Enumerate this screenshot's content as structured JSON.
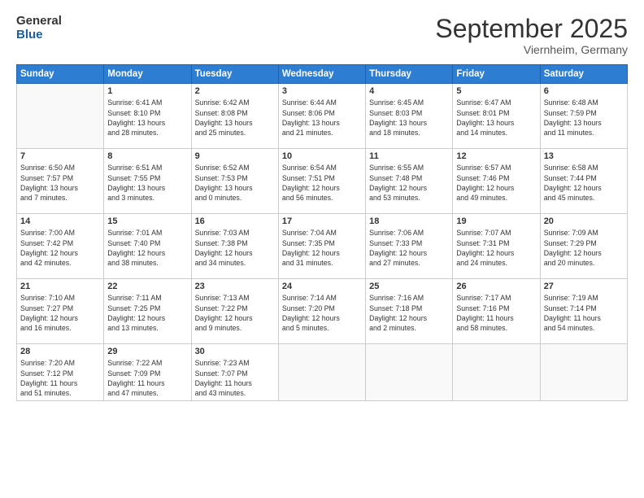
{
  "logo": {
    "general": "General",
    "blue": "Blue"
  },
  "title": "September 2025",
  "location": "Viernheim, Germany",
  "days_of_week": [
    "Sunday",
    "Monday",
    "Tuesday",
    "Wednesday",
    "Thursday",
    "Friday",
    "Saturday"
  ],
  "weeks": [
    [
      {
        "day": "",
        "info": ""
      },
      {
        "day": "1",
        "info": "Sunrise: 6:41 AM\nSunset: 8:10 PM\nDaylight: 13 hours\nand 28 minutes."
      },
      {
        "day": "2",
        "info": "Sunrise: 6:42 AM\nSunset: 8:08 PM\nDaylight: 13 hours\nand 25 minutes."
      },
      {
        "day": "3",
        "info": "Sunrise: 6:44 AM\nSunset: 8:06 PM\nDaylight: 13 hours\nand 21 minutes."
      },
      {
        "day": "4",
        "info": "Sunrise: 6:45 AM\nSunset: 8:03 PM\nDaylight: 13 hours\nand 18 minutes."
      },
      {
        "day": "5",
        "info": "Sunrise: 6:47 AM\nSunset: 8:01 PM\nDaylight: 13 hours\nand 14 minutes."
      },
      {
        "day": "6",
        "info": "Sunrise: 6:48 AM\nSunset: 7:59 PM\nDaylight: 13 hours\nand 11 minutes."
      }
    ],
    [
      {
        "day": "7",
        "info": "Sunrise: 6:50 AM\nSunset: 7:57 PM\nDaylight: 13 hours\nand 7 minutes."
      },
      {
        "day": "8",
        "info": "Sunrise: 6:51 AM\nSunset: 7:55 PM\nDaylight: 13 hours\nand 3 minutes."
      },
      {
        "day": "9",
        "info": "Sunrise: 6:52 AM\nSunset: 7:53 PM\nDaylight: 13 hours\nand 0 minutes."
      },
      {
        "day": "10",
        "info": "Sunrise: 6:54 AM\nSunset: 7:51 PM\nDaylight: 12 hours\nand 56 minutes."
      },
      {
        "day": "11",
        "info": "Sunrise: 6:55 AM\nSunset: 7:48 PM\nDaylight: 12 hours\nand 53 minutes."
      },
      {
        "day": "12",
        "info": "Sunrise: 6:57 AM\nSunset: 7:46 PM\nDaylight: 12 hours\nand 49 minutes."
      },
      {
        "day": "13",
        "info": "Sunrise: 6:58 AM\nSunset: 7:44 PM\nDaylight: 12 hours\nand 45 minutes."
      }
    ],
    [
      {
        "day": "14",
        "info": "Sunrise: 7:00 AM\nSunset: 7:42 PM\nDaylight: 12 hours\nand 42 minutes."
      },
      {
        "day": "15",
        "info": "Sunrise: 7:01 AM\nSunset: 7:40 PM\nDaylight: 12 hours\nand 38 minutes."
      },
      {
        "day": "16",
        "info": "Sunrise: 7:03 AM\nSunset: 7:38 PM\nDaylight: 12 hours\nand 34 minutes."
      },
      {
        "day": "17",
        "info": "Sunrise: 7:04 AM\nSunset: 7:35 PM\nDaylight: 12 hours\nand 31 minutes."
      },
      {
        "day": "18",
        "info": "Sunrise: 7:06 AM\nSunset: 7:33 PM\nDaylight: 12 hours\nand 27 minutes."
      },
      {
        "day": "19",
        "info": "Sunrise: 7:07 AM\nSunset: 7:31 PM\nDaylight: 12 hours\nand 24 minutes."
      },
      {
        "day": "20",
        "info": "Sunrise: 7:09 AM\nSunset: 7:29 PM\nDaylight: 12 hours\nand 20 minutes."
      }
    ],
    [
      {
        "day": "21",
        "info": "Sunrise: 7:10 AM\nSunset: 7:27 PM\nDaylight: 12 hours\nand 16 minutes."
      },
      {
        "day": "22",
        "info": "Sunrise: 7:11 AM\nSunset: 7:25 PM\nDaylight: 12 hours\nand 13 minutes."
      },
      {
        "day": "23",
        "info": "Sunrise: 7:13 AM\nSunset: 7:22 PM\nDaylight: 12 hours\nand 9 minutes."
      },
      {
        "day": "24",
        "info": "Sunrise: 7:14 AM\nSunset: 7:20 PM\nDaylight: 12 hours\nand 5 minutes."
      },
      {
        "day": "25",
        "info": "Sunrise: 7:16 AM\nSunset: 7:18 PM\nDaylight: 12 hours\nand 2 minutes."
      },
      {
        "day": "26",
        "info": "Sunrise: 7:17 AM\nSunset: 7:16 PM\nDaylight: 11 hours\nand 58 minutes."
      },
      {
        "day": "27",
        "info": "Sunrise: 7:19 AM\nSunset: 7:14 PM\nDaylight: 11 hours\nand 54 minutes."
      }
    ],
    [
      {
        "day": "28",
        "info": "Sunrise: 7:20 AM\nSunset: 7:12 PM\nDaylight: 11 hours\nand 51 minutes."
      },
      {
        "day": "29",
        "info": "Sunrise: 7:22 AM\nSunset: 7:09 PM\nDaylight: 11 hours\nand 47 minutes."
      },
      {
        "day": "30",
        "info": "Sunrise: 7:23 AM\nSunset: 7:07 PM\nDaylight: 11 hours\nand 43 minutes."
      },
      {
        "day": "",
        "info": ""
      },
      {
        "day": "",
        "info": ""
      },
      {
        "day": "",
        "info": ""
      },
      {
        "day": "",
        "info": ""
      }
    ]
  ]
}
